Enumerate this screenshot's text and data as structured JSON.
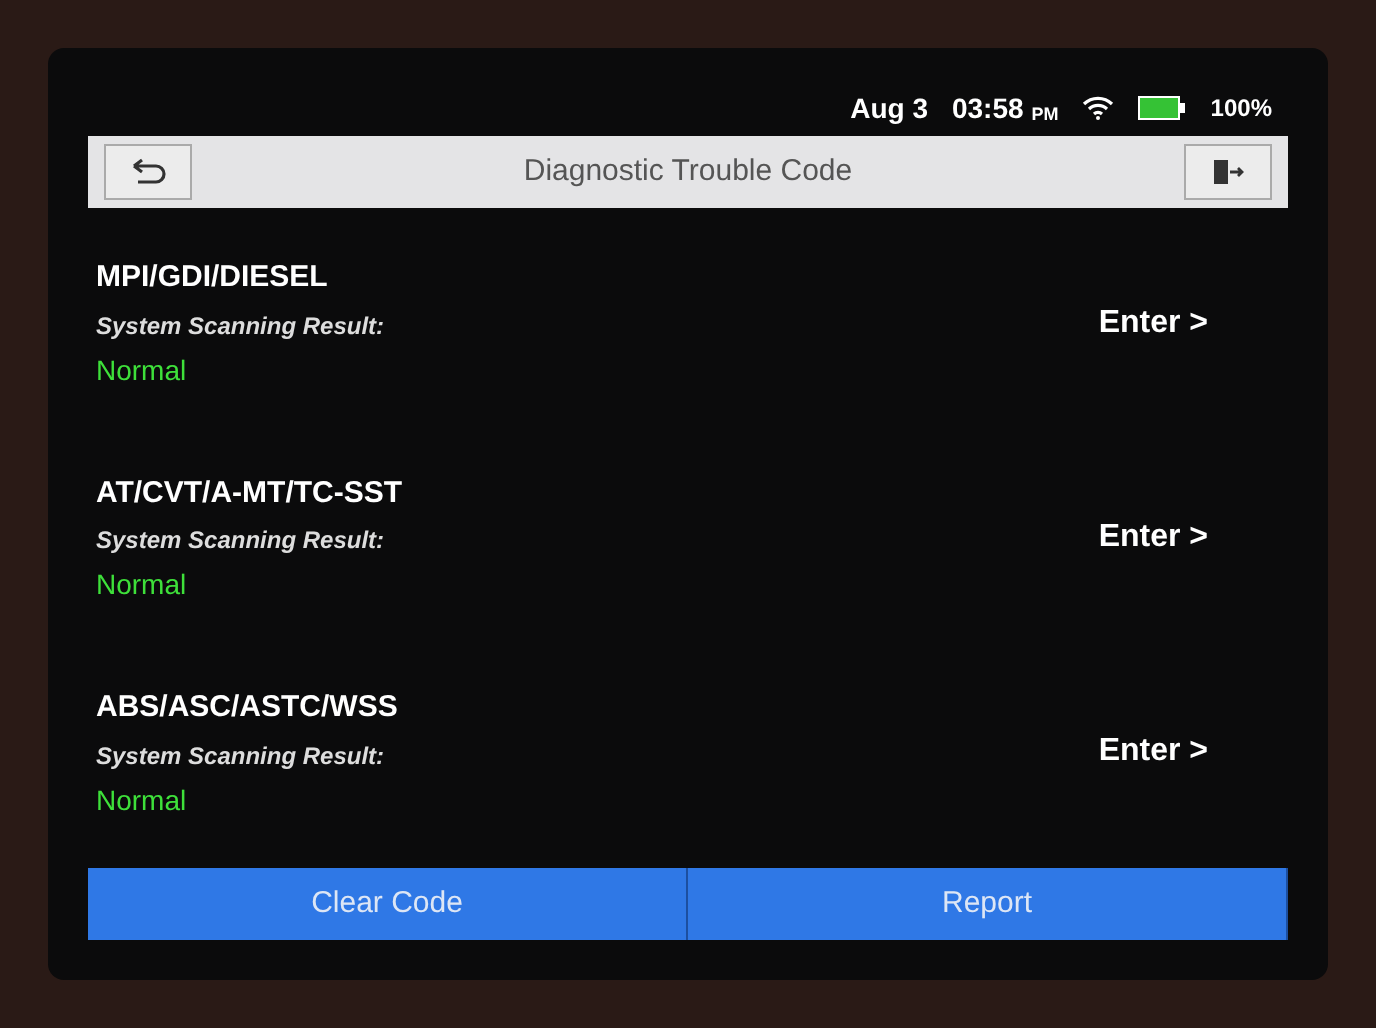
{
  "status_bar": {
    "date": "Aug 3",
    "time": "03:58",
    "ampm": "PM",
    "battery": "100%"
  },
  "title_bar": {
    "title": "Diagnostic Trouble Code"
  },
  "systems": [
    {
      "name": "MPI/GDI/DIESEL",
      "label": "System Scanning Result:",
      "result": "Normal",
      "action": "Enter >"
    },
    {
      "name": "AT/CVT/A-MT/TC-SST",
      "label": "System Scanning Result:",
      "result": "Normal",
      "action": "Enter >"
    },
    {
      "name": "ABS/ASC/ASTC/WSS",
      "label": "System Scanning Result:",
      "result": "Normal",
      "action": "Enter >"
    }
  ],
  "buttons": [
    "Clear Code",
    "Report"
  ]
}
